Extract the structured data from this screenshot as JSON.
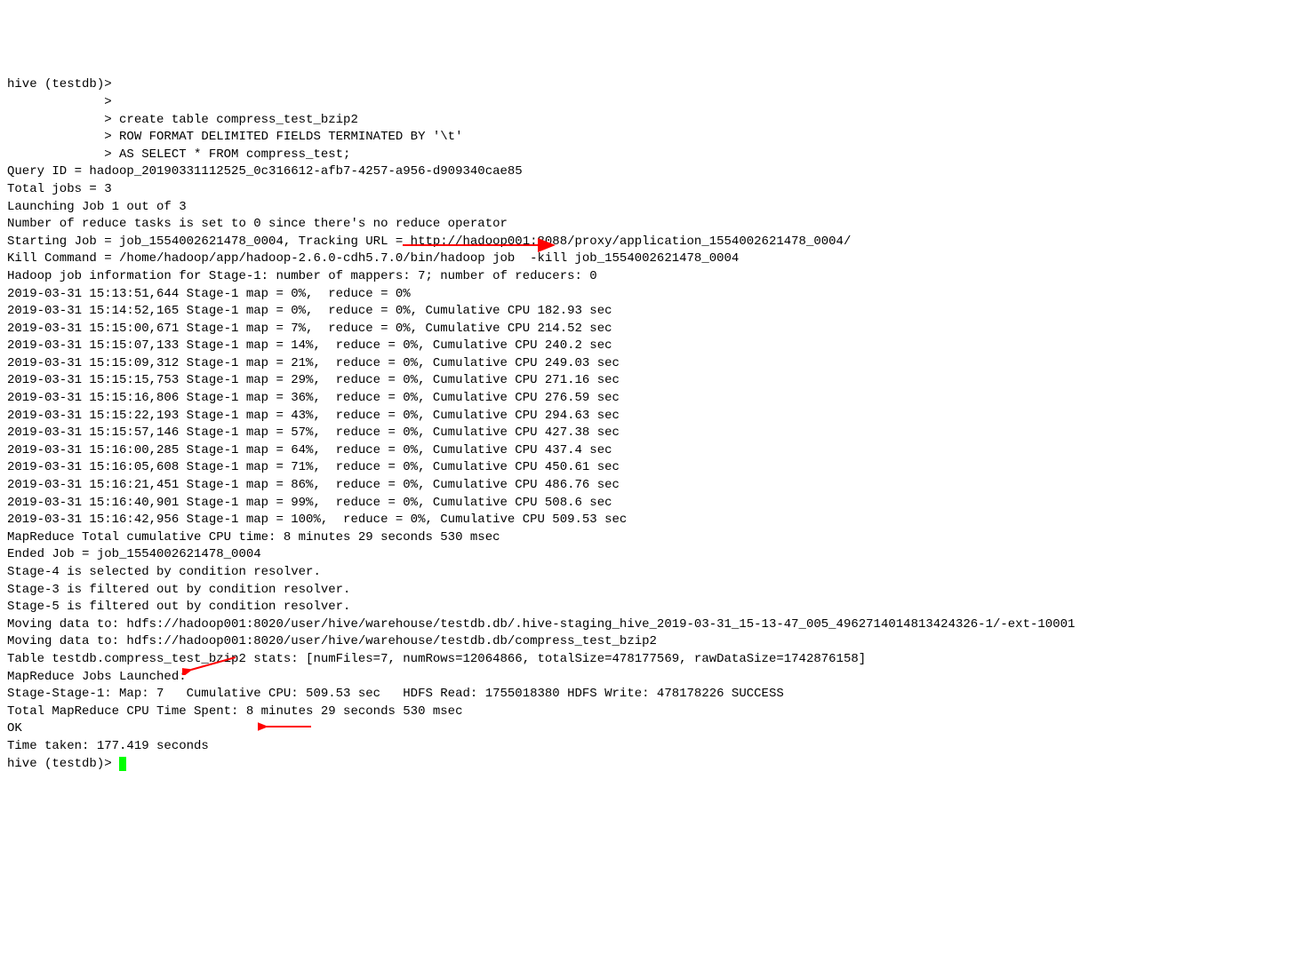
{
  "terminal": {
    "lines": [
      "hive (testdb)>",
      "             >",
      "             > create table compress_test_bzip2",
      "             > ROW FORMAT DELIMITED FIELDS TERMINATED BY '\\t'",
      "             > AS SELECT * FROM compress_test;",
      "Query ID = hadoop_20190331112525_0c316612-afb7-4257-a956-d909340cae85",
      "Total jobs = 3",
      "Launching Job 1 out of 3",
      "Number of reduce tasks is set to 0 since there's no reduce operator",
      "Starting Job = job_1554002621478_0004, Tracking URL = http://hadoop001:8088/proxy/application_1554002621478_0004/",
      "Kill Command = /home/hadoop/app/hadoop-2.6.0-cdh5.7.0/bin/hadoop job  -kill job_1554002621478_0004",
      "Hadoop job information for Stage-1: number of mappers: 7; number of reducers: 0",
      "2019-03-31 15:13:51,644 Stage-1 map = 0%,  reduce = 0%",
      "2019-03-31 15:14:52,165 Stage-1 map = 0%,  reduce = 0%, Cumulative CPU 182.93 sec",
      "2019-03-31 15:15:00,671 Stage-1 map = 7%,  reduce = 0%, Cumulative CPU 214.52 sec",
      "2019-03-31 15:15:07,133 Stage-1 map = 14%,  reduce = 0%, Cumulative CPU 240.2 sec",
      "2019-03-31 15:15:09,312 Stage-1 map = 21%,  reduce = 0%, Cumulative CPU 249.03 sec",
      "2019-03-31 15:15:15,753 Stage-1 map = 29%,  reduce = 0%, Cumulative CPU 271.16 sec",
      "2019-03-31 15:15:16,806 Stage-1 map = 36%,  reduce = 0%, Cumulative CPU 276.59 sec",
      "2019-03-31 15:15:22,193 Stage-1 map = 43%,  reduce = 0%, Cumulative CPU 294.63 sec",
      "2019-03-31 15:15:57,146 Stage-1 map = 57%,  reduce = 0%, Cumulative CPU 427.38 sec",
      "2019-03-31 15:16:00,285 Stage-1 map = 64%,  reduce = 0%, Cumulative CPU 437.4 sec",
      "2019-03-31 15:16:05,608 Stage-1 map = 71%,  reduce = 0%, Cumulative CPU 450.61 sec",
      "2019-03-31 15:16:21,451 Stage-1 map = 86%,  reduce = 0%, Cumulative CPU 486.76 sec",
      "2019-03-31 15:16:40,901 Stage-1 map = 99%,  reduce = 0%, Cumulative CPU 508.6 sec",
      "2019-03-31 15:16:42,956 Stage-1 map = 100%,  reduce = 0%, Cumulative CPU 509.53 sec",
      "MapReduce Total cumulative CPU time: 8 minutes 29 seconds 530 msec",
      "Ended Job = job_1554002621478_0004",
      "Stage-4 is selected by condition resolver.",
      "Stage-3 is filtered out by condition resolver.",
      "Stage-5 is filtered out by condition resolver.",
      "Moving data to: hdfs://hadoop001:8020/user/hive/warehouse/testdb.db/.hive-staging_hive_2019-03-31_15-13-47_005_4962714014813424326-1/-ext-10001",
      "Moving data to: hdfs://hadoop001:8020/user/hive/warehouse/testdb.db/compress_test_bzip2",
      "Table testdb.compress_test_bzip2 stats: [numFiles=7, numRows=12064866, totalSize=478177569, rawDataSize=1742876158]",
      "MapReduce Jobs Launched:",
      "Stage-Stage-1: Map: 7   Cumulative CPU: 509.53 sec   HDFS Read: 1755018380 HDFS Write: 478178226 SUCCESS",
      "Total MapReduce CPU Time Spent: 8 minutes 29 seconds 530 msec",
      "OK",
      "Time taken: 177.419 seconds"
    ],
    "prompt": "hive (testdb)> "
  }
}
